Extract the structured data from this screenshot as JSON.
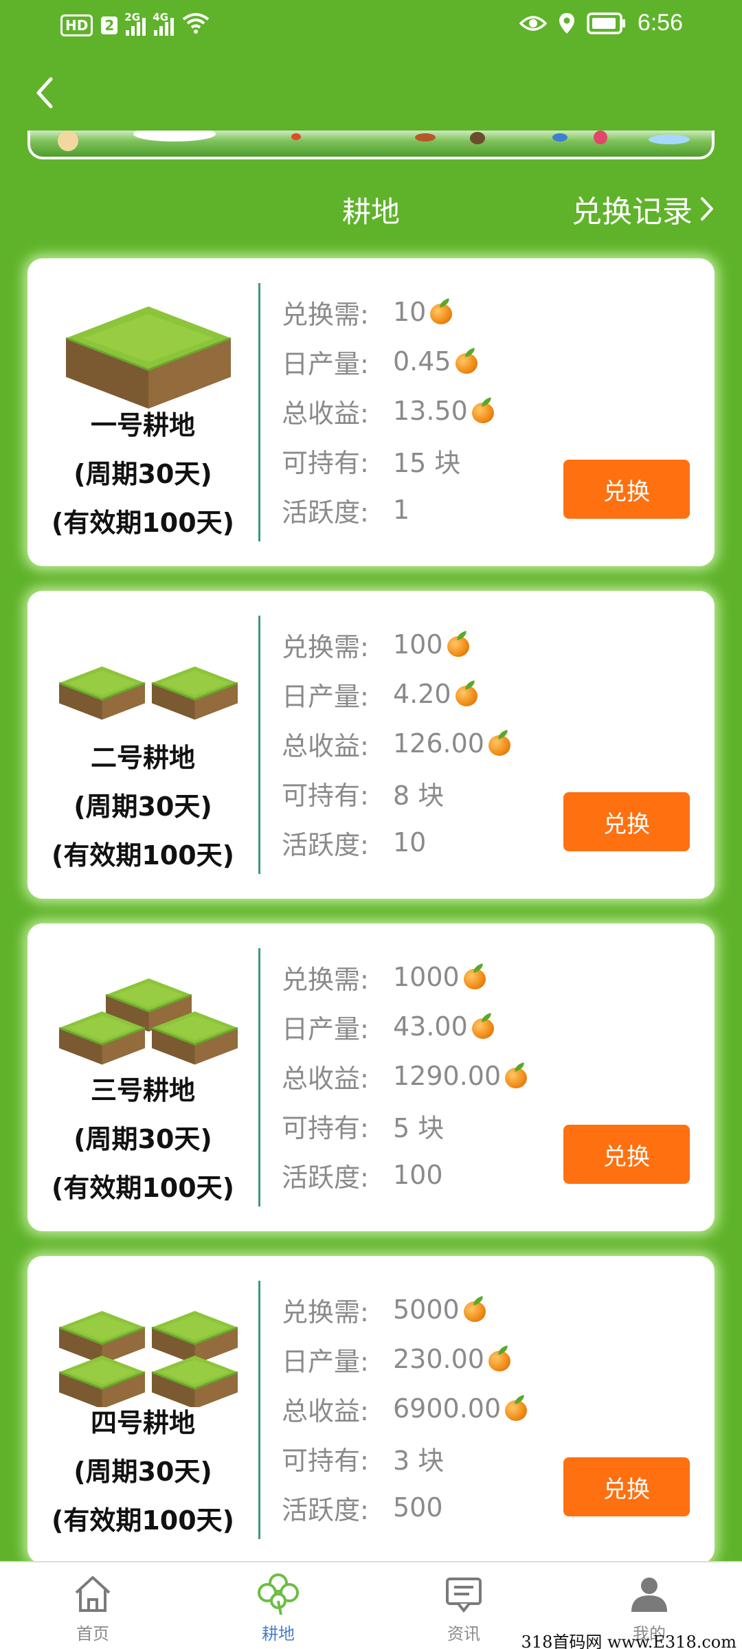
{
  "status_bar": {
    "hd": "HD",
    "sim": "2",
    "net1": "2G",
    "net2": "4G",
    "time": "6:56"
  },
  "header": {
    "tab_title": "耕地",
    "records_label": "兑换记录"
  },
  "fields": [
    {
      "name": "一号耕地",
      "cycle": "(周期30天)",
      "validity": "(有效期100天)",
      "plots": 1,
      "cost_label": "兑换需:",
      "cost": "10",
      "daily_label": "日产量:",
      "daily": "0.45",
      "total_label": "总收益:",
      "total": "13.50",
      "hold_label": "可持有:",
      "hold": "15 块",
      "activity_label": "活跃度:",
      "activity": "1",
      "button": "兑换"
    },
    {
      "name": "二号耕地",
      "cycle": "(周期30天)",
      "validity": "(有效期100天)",
      "plots": 2,
      "cost_label": "兑换需:",
      "cost": "100",
      "daily_label": "日产量:",
      "daily": "4.20",
      "total_label": "总收益:",
      "total": "126.00",
      "hold_label": "可持有:",
      "hold": "8 块",
      "activity_label": "活跃度:",
      "activity": "10",
      "button": "兑换"
    },
    {
      "name": "三号耕地",
      "cycle": "(周期30天)",
      "validity": "(有效期100天)",
      "plots": 3,
      "cost_label": "兑换需:",
      "cost": "1000",
      "daily_label": "日产量:",
      "daily": "43.00",
      "total_label": "总收益:",
      "total": "1290.00",
      "hold_label": "可持有:",
      "hold": "5 块",
      "activity_label": "活跃度:",
      "activity": "100",
      "button": "兑换"
    },
    {
      "name": "四号耕地",
      "cycle": "(周期30天)",
      "validity": "(有效期100天)",
      "plots": 4,
      "cost_label": "兑换需:",
      "cost": "5000",
      "daily_label": "日产量:",
      "daily": "230.00",
      "total_label": "总收益:",
      "total": "6900.00",
      "hold_label": "可持有:",
      "hold": "3 块",
      "activity_label": "活跃度:",
      "activity": "500",
      "button": "兑换"
    }
  ],
  "bottom_nav": [
    {
      "label": "首页",
      "icon": "home-icon",
      "active": false
    },
    {
      "label": "耕地",
      "icon": "clover-icon",
      "active": true
    },
    {
      "label": "资讯",
      "icon": "message-icon",
      "active": false
    },
    {
      "label": "我的",
      "icon": "profile-icon",
      "active": false
    }
  ],
  "watermark": "318首码网 www.E318.com",
  "colors": {
    "background": "#5fb32a",
    "button": "#fe7010",
    "divider": "#3c9a7c",
    "active_nav": "#4a7fc9"
  }
}
